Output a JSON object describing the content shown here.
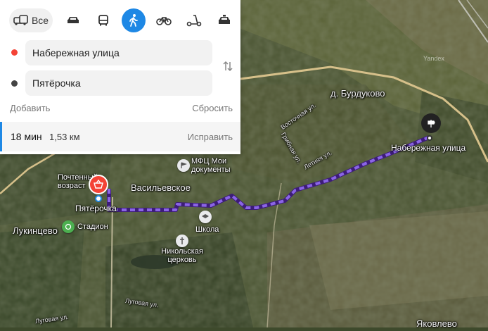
{
  "transport_modes": {
    "all_label": "Все",
    "modes": [
      "car-icon",
      "bus-icon",
      "walk-icon",
      "bike-icon",
      "scooter-icon",
      "taxi-icon"
    ],
    "active": "walk"
  },
  "route_form": {
    "from_value": "Набережная улица",
    "to_value": "Пятёрочка",
    "add_label": "Добавить",
    "reset_label": "Сбросить",
    "from_dot_color": "#f44336",
    "to_dot_color": "#444444"
  },
  "route_summary": {
    "time": "18 мин",
    "distance": "1,53 км",
    "fix_label": "Исправить"
  },
  "map": {
    "villages": [
      "Васильевское",
      "д. Бурдуково",
      "Лукинцево",
      "Яковлево"
    ],
    "pois": {
      "mfc": "МФЦ Мои документы",
      "school": "Школа",
      "church": "Никольская церковь",
      "stadium": "Стадион",
      "post": "Почтенный возраст"
    },
    "streets": [
      "Восточная ул.",
      "Грибная ул.",
      "Летняя ул.",
      "Луговая ул.",
      "Луговая ул."
    ],
    "watermark": "Yandex",
    "destination_label": "Пятёрочка",
    "origin_label": "Набережная улица",
    "route_color": "#7b55d6"
  }
}
